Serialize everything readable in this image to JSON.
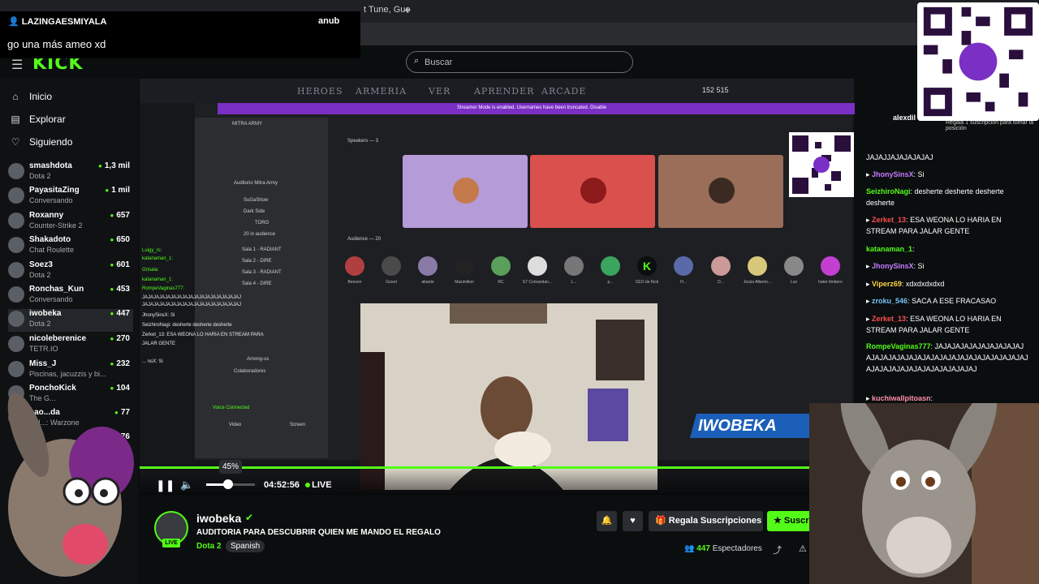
{
  "browser": {
    "tab_partial": "t Tune, Gue",
    "tab_add": "+"
  },
  "notification": {
    "user": "LAZINGAESMIYALA",
    "user2": "anub",
    "message": "go una más ameo xd"
  },
  "header": {
    "logo": "KICK",
    "search_placeholder": "Buscar"
  },
  "nav": [
    {
      "label": "Inicio",
      "icon": "home-icon"
    },
    {
      "label": "Explorar",
      "icon": "explore-icon"
    },
    {
      "label": "Siguiendo",
      "icon": "heart-icon"
    }
  ],
  "channels": [
    {
      "name": "smashdota",
      "game": "Dota 2",
      "viewers": "1,3 mil"
    },
    {
      "name": "PayasitaZing",
      "game": "Conversando",
      "viewers": "1 mil"
    },
    {
      "name": "Roxanny",
      "game": "Counter-Strike 2",
      "viewers": "657"
    },
    {
      "name": "Shakadoto",
      "game": "Chat Roulette",
      "viewers": "650"
    },
    {
      "name": "Soez3",
      "game": "Dota 2",
      "viewers": "601"
    },
    {
      "name": "Ronchas_Kun",
      "game": "Conversando",
      "viewers": "453"
    },
    {
      "name": "iwobeka",
      "game": "Dota 2",
      "viewers": "447"
    },
    {
      "name": "nicoleberenice",
      "game": "TETR.IO",
      "viewers": "270"
    },
    {
      "name": "Miss_J",
      "game": "Piscinas, jacuzzis y bi...",
      "viewers": "232"
    },
    {
      "name": "PonchoKick",
      "game": "The G...",
      "viewers": "104"
    },
    {
      "name": "pao...da",
      "game": "Cal...: Warzone",
      "viewers": "77"
    },
    {
      "name": "",
      "game": "",
      "viewers": "76"
    }
  ],
  "game_tabs": [
    "HEROES",
    "ARMERIA",
    "VER",
    "APRENDER",
    "ARCADE"
  ],
  "game_gold": "152  515",
  "stream_overlay": {
    "banner": "Streamer Mode is enabled. Usernames have been truncated.  Disable",
    "server": "MITRA ARMY",
    "voice_channel": "Auditorio Mitra Army",
    "speakers": "Speakers — 3",
    "audience": "Audience — 20",
    "overlay_name": "IWOBEKA",
    "left_channels": [
      "Auditorio Mitra Army",
      "SuGaShow",
      "Dark Side",
      "TORO",
      "20 in audience",
      "Sala 1 - RADIANT",
      "Sala 2 - DIRE",
      "Sala 3 - RADIANT",
      "Sala 4 - DIRE",
      "Among-us",
      "Colaboradores"
    ],
    "voice_connected": "Voice Connected",
    "video_btn": "Video",
    "screen_btn": "Screen",
    "audience_names": [
      "Benson",
      "Grzed",
      "abante",
      "Maximilion",
      "RC",
      "S7 Comandan...",
      "L...",
      "p...",
      "CEO de Kick",
      "H...",
      "D...",
      "Jesús Alberto...",
      "Lun",
      "hater timbero"
    ],
    "overlay_chat": [
      "Luigy_rs:",
      "katanaman_1:",
      "Grisala:",
      "katanaman_1:",
      "RompeVaginas777:",
      "JAJAJAJAJAJAJAJAJAJAJAJAJAJAJAJAJAJ",
      "JAJAJAJAJAJAJAJAJAJAJAJAJAJAJAJAJAJ",
      "JhonySinsX: Si",
      "SeizhiroNagi: desherte desherte desherte",
      "Zerket_13: ESA WEONA LO HARIA EN STREAM PARA",
      "JALAR GENTE",
      "... nsX: Si"
    ]
  },
  "player": {
    "volume_tip": "45%",
    "volume": 0.45,
    "time": "04:52:56",
    "live": "LIVE"
  },
  "stream_info": {
    "channel": "iwobeka",
    "title": "AUDITORIA PARA  DESCUBRIR QUIEN ME MANDO EL REGALO",
    "category": "Dota 2",
    "language": "Spanish",
    "live_badge": "LIVE",
    "gift_label": "Regala Suscripciones",
    "subscribe_label": "Suscri",
    "viewers_count": "447",
    "viewers_label": "Espectadores"
  },
  "chat": {
    "pinned_user": "alexdil",
    "pinned_sub": "Regala 1 suscripcion para tomar la posición",
    "messages": [
      {
        "user": "",
        "text": "JAJAJJAJAJAJAJAJ",
        "color": "#ffffff"
      },
      {
        "user": "JhonySinsX",
        "text": ": Si",
        "color": "#c77dff"
      },
      {
        "user": "SeizhiroNagi",
        "text": ": desherte desherte desherte desherte",
        "color": "#53fc18"
      },
      {
        "user": "Zerket_13",
        "text": ": ESA WEONA LO HARIA EN STREAM PARA JALAR GENTE",
        "color": "#ff4d4d"
      },
      {
        "user": "katanaman_1",
        "text": ":",
        "color": "#53fc18"
      },
      {
        "user": "JhonySinsX",
        "text": ": Si",
        "color": "#c77dff"
      },
      {
        "user": "Viperz69",
        "text": ": xdxdxdxdxd",
        "color": "#ffd43b"
      },
      {
        "user": "zroku_546",
        "text": ": SACA A ESE FRACASAO",
        "color": "#74c0fc"
      },
      {
        "user": "Zerket_13",
        "text": ": ESA WEONA LO HARIA EN STREAM PARA JALAR GENTE",
        "color": "#ff4d4d"
      },
      {
        "user": "RompeVaginas777",
        "text": ": JAJAJAJAJAJAJAJAJAJAJAJAJAJAJAJAJAJAJAJAJAJAJAJAJAJAJAJAJAJAJAJAJAJAJAJAJAJAJAJAJAJAJ",
        "color": "#53fc18"
      },
      {
        "user": "kuchiwallpitoasn",
        "text": ":",
        "color": "#ff8fab"
      }
    ]
  },
  "colors": {
    "accent": "#53fc18",
    "background": "#0b0e0f",
    "purple": "#7a2fc5"
  }
}
